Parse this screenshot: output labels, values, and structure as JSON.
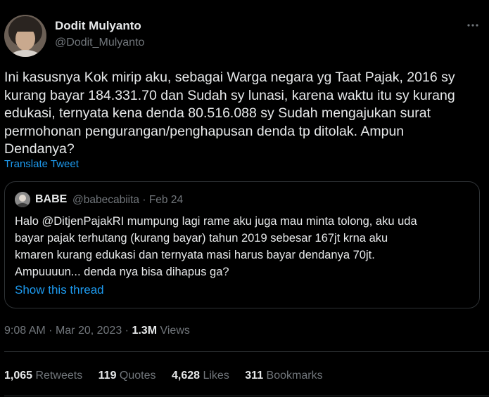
{
  "author": {
    "display_name": "Dodit Mulyanto",
    "handle": "@Dodit_Mulyanto",
    "avatar_icon": "user-avatar"
  },
  "more_icon": "more-options-icon",
  "tweet": {
    "text": "Ini kasusnya Kok mirip aku, sebagai Warga negara yg Taat  Pajak, 2016 sy\nkurang bayar 184.331.70 dan Sudah sy lunasi, karena waktu itu sy kurang\nedukasi, ternyata kena denda 80.516.088 sy Sudah mengajukan surat\npermohonan pengurangan/penghapusan denda tp ditolak. Ampun\nDendanya?",
    "translate_label": "Translate Tweet"
  },
  "quoted": {
    "name": "BABE",
    "handle": "@babecabiita",
    "separator": "·",
    "date": "Feb 24",
    "text": "Halo @DitjenPajakRI mumpung lagi rame aku juga mau minta tolong, aku uda\nbayar pajak terhutang (kurang bayar) tahun 2019 sebesar 167jt krna aku\nkmaren kurang edukasi dan ternyata masi harus bayar dendanya 70jt.\nAmpuuuun... denda nya bisa dihapus ga?",
    "show_thread_label": "Show this thread"
  },
  "meta": {
    "time": "9:08 AM",
    "separator": "·",
    "date": "Mar 20, 2023",
    "views_count": "1.3M",
    "views_label": "Views"
  },
  "stats": {
    "retweets_count": "1,065",
    "retweets_label": "Retweets",
    "quotes_count": "119",
    "quotes_label": "Quotes",
    "likes_count": "4,628",
    "likes_label": "Likes",
    "bookmarks_count": "311",
    "bookmarks_label": "Bookmarks"
  },
  "colors": {
    "background": "#000000",
    "text_primary": "#e7e9ea",
    "text_secondary": "#71767b",
    "link": "#1d9bf0",
    "border": "#2f3336"
  }
}
